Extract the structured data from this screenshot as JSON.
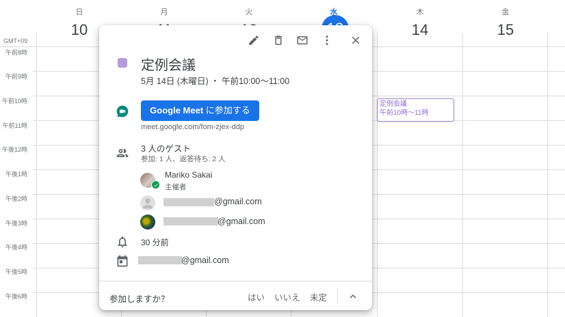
{
  "timezone": "GMT+09",
  "days": [
    {
      "dow": "日",
      "num": "10"
    },
    {
      "dow": "月",
      "num": "11"
    },
    {
      "dow": "火",
      "num": "12"
    },
    {
      "dow": "水",
      "num": "13"
    },
    {
      "dow": "木",
      "num": "14"
    },
    {
      "dow": "金",
      "num": "15"
    }
  ],
  "hours": [
    "午前8時",
    "午前9時",
    "午前10時",
    "午前11時",
    "午後12時",
    "午後1時",
    "午後2時",
    "午後3時",
    "午後4時",
    "午後5時",
    "午後6時"
  ],
  "calendar_event": {
    "title": "定例会議",
    "time": "午前10時～11時"
  },
  "popup": {
    "title": "定例会議",
    "date_time": "5月 14日 (木曜日) ・ 午前10:00～11:00",
    "event_color": "#b39ddb",
    "meet": {
      "brand": "Google Meet",
      "join_suffix": " に参加する",
      "url": "meet.google.com/fom-zjex-ddp"
    },
    "guests": {
      "count_label": "3 人のゲスト",
      "summary": "参加: 1 人、返答待ち: 2 人",
      "organizer": {
        "name": "Mariko Sakai",
        "role": "主催者"
      },
      "email_1_suffix": "@gmail.com",
      "email_2_suffix": "@gmail.com"
    },
    "reminder": "30 分前",
    "calendar_owner_suffix": "@gmail.com",
    "rsvp": {
      "question": "参加しますか？",
      "yes": "はい",
      "no": "いいえ",
      "maybe": "未定"
    }
  },
  "colors": {
    "accent": "#1a73e8",
    "event": "#8e6fd6"
  }
}
